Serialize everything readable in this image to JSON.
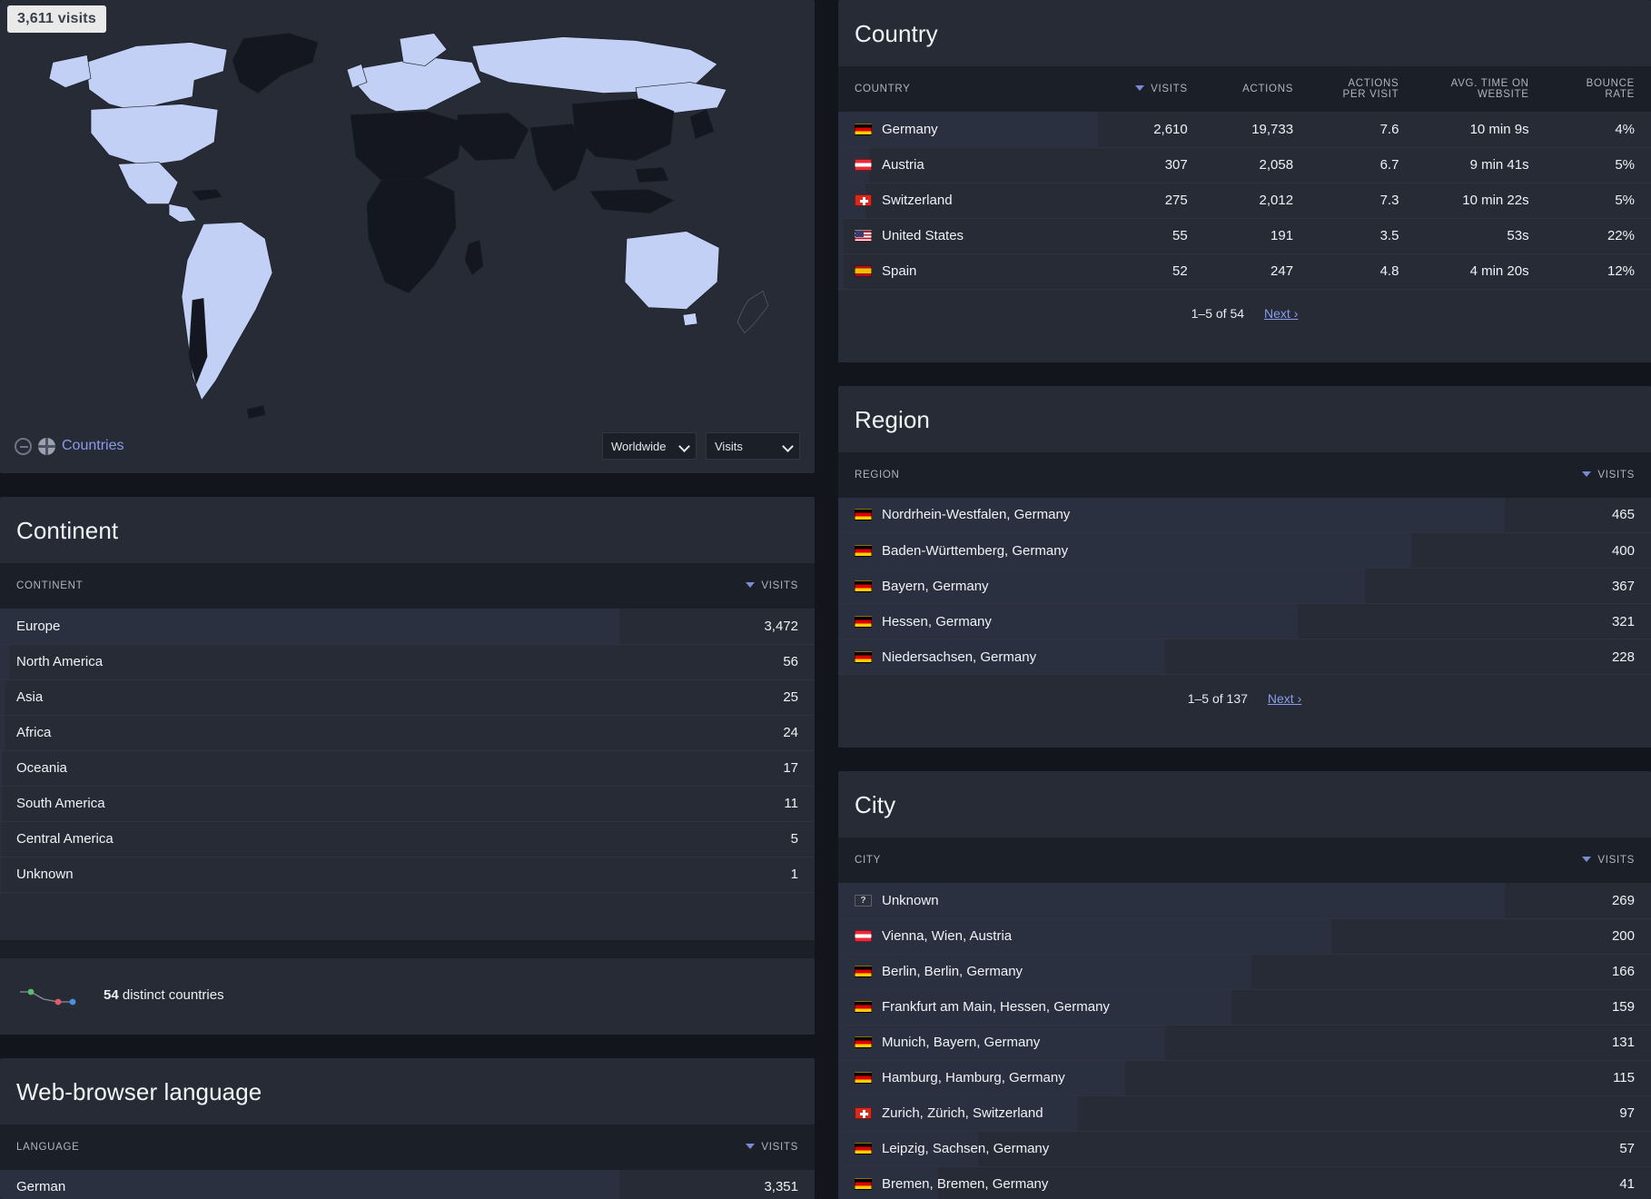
{
  "map": {
    "visits_badge": "3,611 visits",
    "legend_link": "Countries",
    "zoom_icon": "zoom-out-icon",
    "globe_icon": "globe-icon",
    "region_select": {
      "value": "Worldwide",
      "options": [
        "Worldwide"
      ]
    },
    "metric_select": {
      "value": "Visits",
      "options": [
        "Visits"
      ]
    }
  },
  "country": {
    "title": "Country",
    "columns": {
      "label": "COUNTRY",
      "visits": "VISITS",
      "actions": "ACTIONS",
      "actions_per_visit": "ACTIONS PER VISIT",
      "avg_time": "AVG. TIME ON WEBSITE",
      "bounce_rate": "BOUNCE RATE"
    },
    "sorted_by": "VISITS",
    "rows": [
      {
        "flag": "de",
        "label": "Germany",
        "visits": "2,610",
        "actions": "19,733",
        "apv": "7.6",
        "time": "10 min 9s",
        "bounce": "4%",
        "bar_pct": 100
      },
      {
        "flag": "at",
        "label": "Austria",
        "visits": "307",
        "actions": "2,058",
        "apv": "6.7",
        "time": "9 min 41s",
        "bounce": "5%",
        "bar_pct": 11.8
      },
      {
        "flag": "ch",
        "label": "Switzerland",
        "visits": "275",
        "actions": "2,012",
        "apv": "7.3",
        "time": "10 min 22s",
        "bounce": "5%",
        "bar_pct": 10.5
      },
      {
        "flag": "us",
        "label": "United States",
        "visits": "55",
        "actions": "191",
        "apv": "3.5",
        "time": "53s",
        "bounce": "22%",
        "bar_pct": 2.1
      },
      {
        "flag": "es",
        "label": "Spain",
        "visits": "52",
        "actions": "247",
        "apv": "4.8",
        "time": "4 min 20s",
        "bounce": "12%",
        "bar_pct": 2.0
      }
    ],
    "pagination": {
      "range": "1–5 of 54",
      "next": "Next ›"
    }
  },
  "continent": {
    "title": "Continent",
    "columns": {
      "label": "CONTINENT",
      "visits": "VISITS"
    },
    "sorted_by": "VISITS",
    "rows": [
      {
        "label": "Europe",
        "visits": "3,472",
        "bar_pct": 100
      },
      {
        "label": "North America",
        "visits": "56",
        "bar_pct": 1.6
      },
      {
        "label": "Asia",
        "visits": "25",
        "bar_pct": 0.72
      },
      {
        "label": "Africa",
        "visits": "24",
        "bar_pct": 0.69
      },
      {
        "label": "Oceania",
        "visits": "17",
        "bar_pct": 0.49
      },
      {
        "label": "South America",
        "visits": "11",
        "bar_pct": 0.32
      },
      {
        "label": "Central America",
        "visits": "5",
        "bar_pct": 0.14
      },
      {
        "label": "Unknown",
        "visits": "1",
        "bar_pct": 0.03
      }
    ],
    "footer": {
      "count": "54",
      "text": " distinct countries"
    }
  },
  "region": {
    "title": "Region",
    "columns": {
      "label": "REGION",
      "visits": "VISITS"
    },
    "sorted_by": "VISITS",
    "rows": [
      {
        "flag": "de",
        "label": "Nordrhein-Westfalen, Germany",
        "visits": "465",
        "bar_pct": 100
      },
      {
        "flag": "de",
        "label": "Baden-Württemberg, Germany",
        "visits": "400",
        "bar_pct": 86
      },
      {
        "flag": "de",
        "label": "Bayern, Germany",
        "visits": "367",
        "bar_pct": 79
      },
      {
        "flag": "de",
        "label": "Hessen, Germany",
        "visits": "321",
        "bar_pct": 69
      },
      {
        "flag": "de",
        "label": "Niedersachsen, Germany",
        "visits": "228",
        "bar_pct": 49
      }
    ],
    "pagination": {
      "range": "1–5 of 137",
      "next": "Next ›"
    }
  },
  "city": {
    "title": "City",
    "columns": {
      "label": "CITY",
      "visits": "VISITS"
    },
    "sorted_by": "VISITS",
    "rows": [
      {
        "flag": "unknown",
        "label": "Unknown",
        "visits": "269",
        "bar_pct": 100
      },
      {
        "flag": "at",
        "label": "Vienna, Wien, Austria",
        "visits": "200",
        "bar_pct": 74
      },
      {
        "flag": "de",
        "label": "Berlin, Berlin, Germany",
        "visits": "166",
        "bar_pct": 62
      },
      {
        "flag": "de",
        "label": "Frankfurt am Main, Hessen, Germany",
        "visits": "159",
        "bar_pct": 59
      },
      {
        "flag": "de",
        "label": "Munich, Bayern, Germany",
        "visits": "131",
        "bar_pct": 49
      },
      {
        "flag": "de",
        "label": "Hamburg, Hamburg, Germany",
        "visits": "115",
        "bar_pct": 43
      },
      {
        "flag": "ch",
        "label": "Zurich, Zürich, Switzerland",
        "visits": "97",
        "bar_pct": 36
      },
      {
        "flag": "de",
        "label": "Leipzig, Sachsen, Germany",
        "visits": "57",
        "bar_pct": 21
      },
      {
        "flag": "de",
        "label": "Bremen, Bremen, Germany",
        "visits": "41",
        "bar_pct": 15
      }
    ]
  },
  "language": {
    "title": "Web-browser language",
    "columns": {
      "label": "LANGUAGE",
      "visits": "VISITS"
    },
    "sorted_by": "VISITS",
    "rows": [
      {
        "label": "German",
        "visits": "3,351",
        "bar_pct": 100
      }
    ]
  },
  "colors": {
    "page_bg": "#12151c",
    "card_bg": "#262b36",
    "header_bg": "#1b1f27",
    "accent_link": "#8c9bec",
    "sort_caret": "#7b8ad6",
    "map_land_active": "#c3d0f5",
    "map_land_inactive": "#11141b"
  }
}
